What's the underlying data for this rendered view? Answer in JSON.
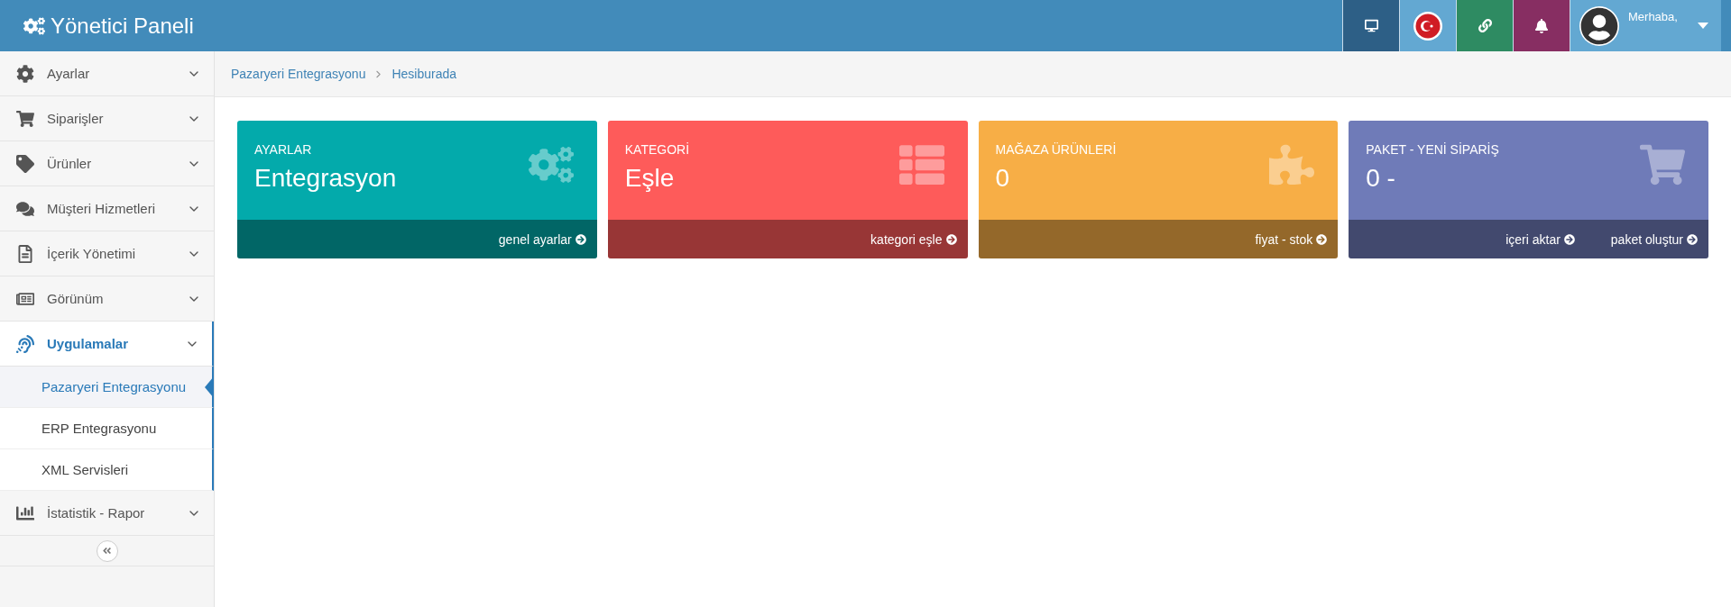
{
  "header": {
    "title": "Yönetici Paneli",
    "greeting": "Merhaba,"
  },
  "sidebar": {
    "items": [
      {
        "label": "Ayarlar",
        "selected": false
      },
      {
        "label": "Siparişler",
        "selected": false
      },
      {
        "label": "Ürünler",
        "selected": false
      },
      {
        "label": "Müşteri Hizmetleri",
        "selected": false
      },
      {
        "label": "İçerik Yönetimi",
        "selected": false
      },
      {
        "label": "Görünüm",
        "selected": false
      },
      {
        "label": "Uygulamalar",
        "selected": true,
        "children": [
          {
            "label": "Pazaryeri Entegrasyonu",
            "selected": true
          },
          {
            "label": "ERP Entegrasyonu",
            "selected": false
          },
          {
            "label": "XML Servisleri",
            "selected": false
          }
        ]
      },
      {
        "label": "İstatistik - Rapor",
        "selected": false
      }
    ]
  },
  "breadcrumb": [
    "Pazaryeri Entegrasyonu",
    "Hesiburada"
  ],
  "cards": [
    {
      "label": "AYARLAR",
      "value": "Entegrasyon",
      "color": "#03aaab",
      "links": [
        "genel ayarlar"
      ]
    },
    {
      "label": "KATEGORİ",
      "value": "Eşle",
      "color": "#fe5b5a",
      "links": [
        "kategori eşle"
      ]
    },
    {
      "label": "MAĞAZA ÜRÜNLERİ",
      "value": "0",
      "color": "#f7ae46",
      "links": [
        "fiyat - stok"
      ]
    },
    {
      "label": "PAKET - YENİ SİPARİŞ",
      "value": "0 -",
      "color": "#6f7bb8",
      "links": [
        "içeri aktar",
        "paket oluştur"
      ]
    }
  ]
}
